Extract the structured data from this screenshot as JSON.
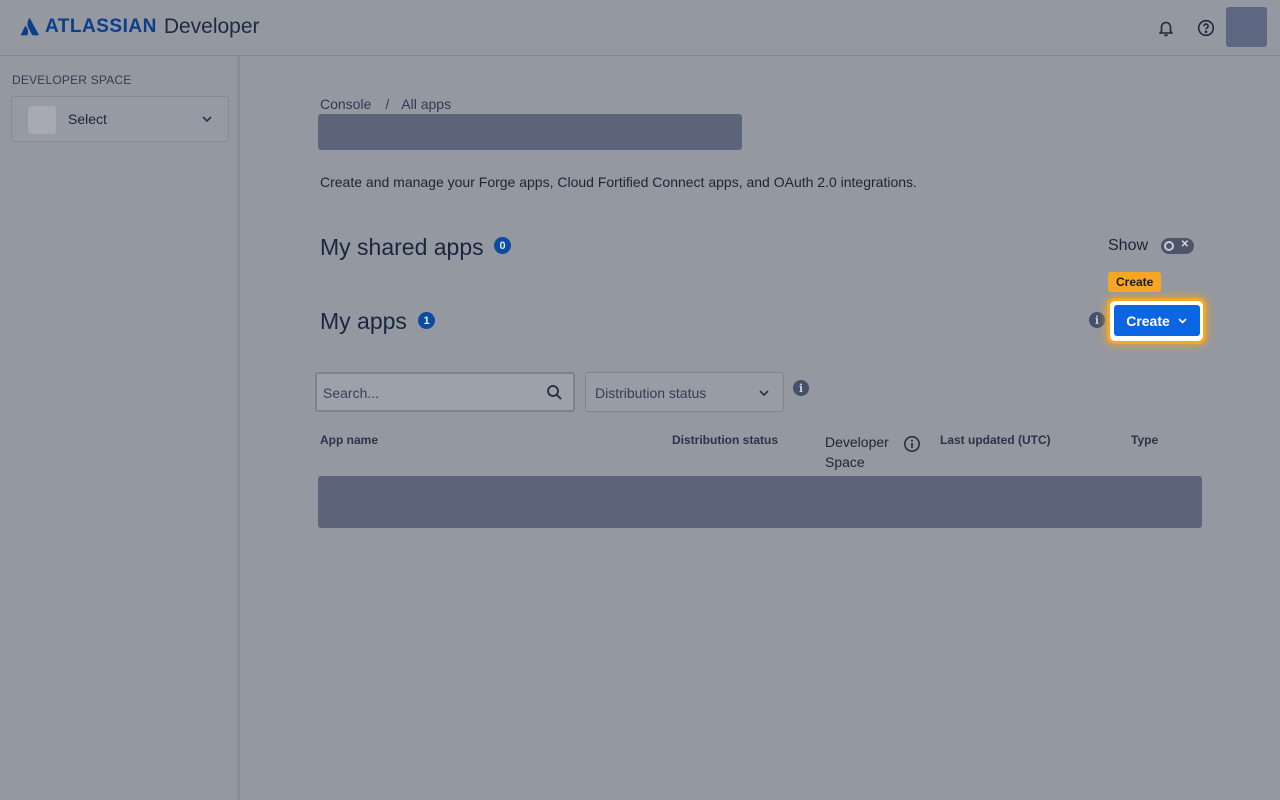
{
  "header": {
    "brand": "ATLASSIAN",
    "product": "Developer",
    "icons": [
      "notification-bell-icon",
      "help-icon"
    ]
  },
  "sidebar": {
    "heading": "DEVELOPER SPACE",
    "select_label": "Select"
  },
  "breadcrumb": {
    "items": [
      "Console",
      "All apps"
    ],
    "separator": "/"
  },
  "description": "Create and manage your Forge apps, Cloud Fortified Connect apps, and OAuth 2.0 integrations.",
  "shared_apps": {
    "title": "My shared apps",
    "count": "0",
    "show_label": "Show",
    "toggle_on": false
  },
  "my_apps": {
    "title": "My apps",
    "count": "1",
    "create_tooltip": "Create",
    "create_label": "Create"
  },
  "filters": {
    "search_placeholder": "Search...",
    "status_placeholder": "Distribution status"
  },
  "table": {
    "columns": [
      "App name",
      "Distribution status",
      "Developer",
      "Space",
      "Last updated (UTC)",
      "Type"
    ]
  },
  "colors": {
    "primary": "#0c66e4",
    "highlight": "#f5a623",
    "badge": "#0c4ba0"
  }
}
